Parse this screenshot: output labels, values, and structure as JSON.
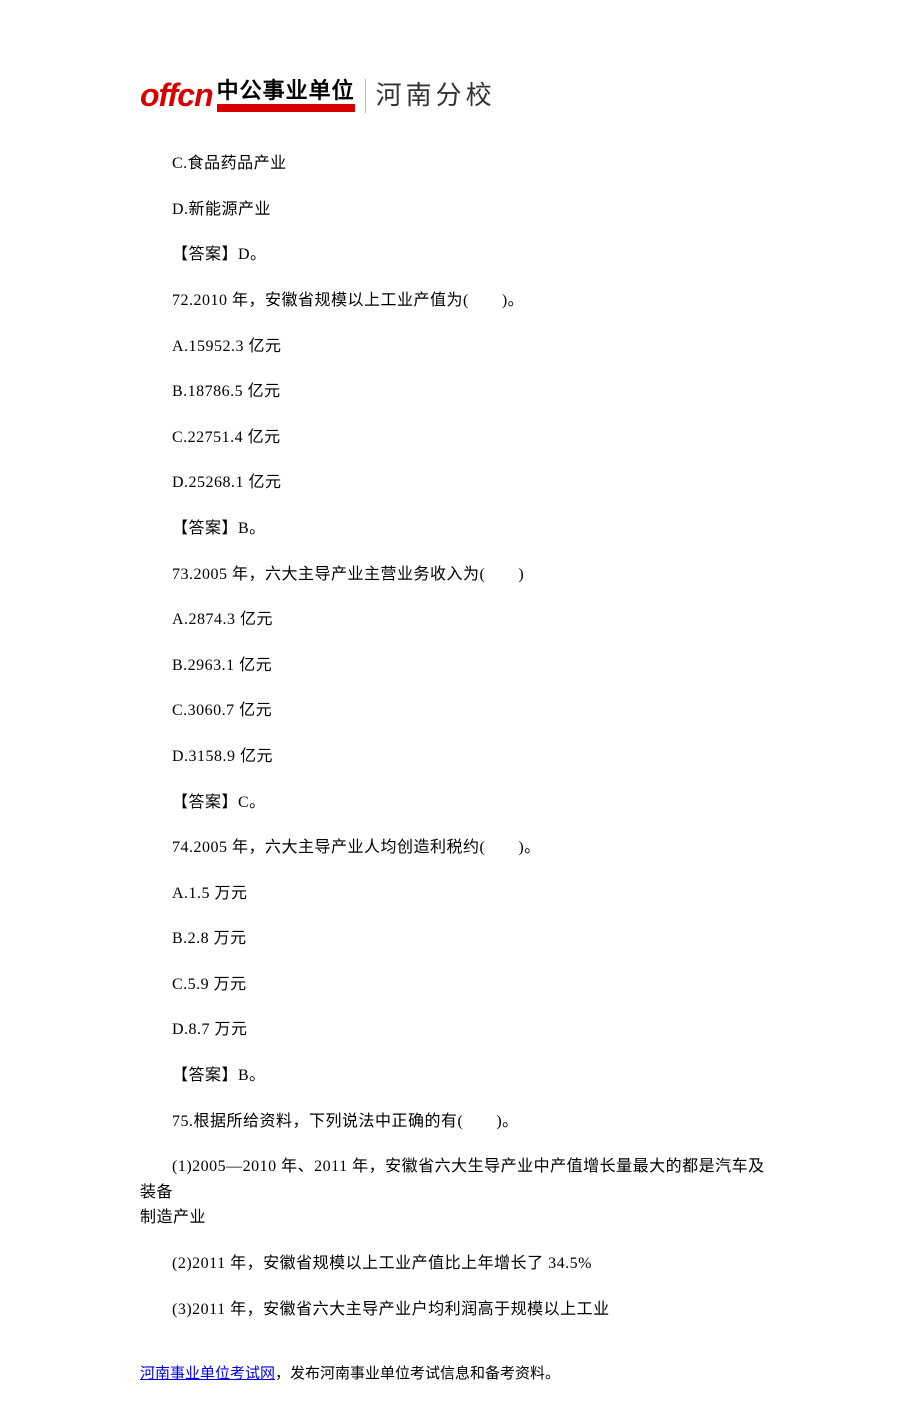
{
  "logo": {
    "offcn": "offcn",
    "cn_main": "中公事业单位",
    "branch": "河南分校"
  },
  "lines": {
    "l1": "C.食品药品产业",
    "l2": "D.新能源产业",
    "l3": "【答案】D。",
    "l4": "72.2010 年，安徽省规模以上工业产值为(　　)。",
    "l5": "A.15952.3 亿元",
    "l6": "B.18786.5 亿元",
    "l7": "C.22751.4 亿元",
    "l8": "D.25268.1 亿元",
    "l9": "【答案】B。",
    "l10": "73.2005 年，六大主导产业主营业务收入为(　　)",
    "l11": "A.2874.3 亿元",
    "l12": "B.2963.1 亿元",
    "l13": "C.3060.7 亿元",
    "l14": "D.3158.9 亿元",
    "l15": "【答案】C。",
    "l16": "74.2005 年，六大主导产业人均创造利税约(　　)。",
    "l17": "A.1.5 万元",
    "l18": "B.2.8 万元",
    "l19": "C.5.9 万元",
    "l20": "D.8.7 万元",
    "l21": "【答案】B。",
    "l22": "75.根据所给资料，下列说法中正确的有(　　)。",
    "l23a": "(1)2005—2010 年、2011 年，安徽省六大生导产业中产值增长量最大的都是汽车及装备",
    "l23b": "制造产业",
    "l24": "(2)2011 年，安徽省规模以上工业产值比上年增长了 34.5%",
    "l25": "(3)2011 年，安徽省六大主导产业户均利润高于规模以上工业"
  },
  "footer": {
    "link_text": "河南事业单位考试网",
    "tail_text": "，发布河南事业单位考试信息和备考资料。"
  }
}
